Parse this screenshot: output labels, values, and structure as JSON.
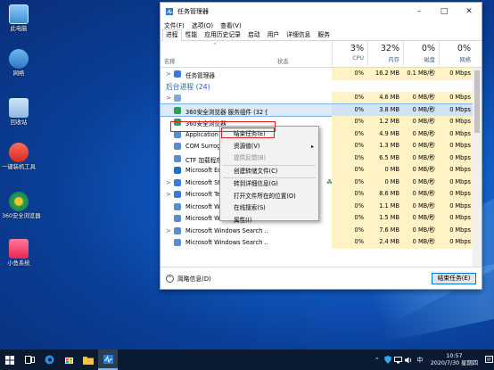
{
  "desktop": {
    "icons": [
      {
        "label": "此电脑",
        "icon": "computer-icon"
      },
      {
        "label": "网络",
        "icon": "network-icon"
      },
      {
        "label": "回收站",
        "icon": "recycle-bin-icon"
      },
      {
        "label": "一键装机工具",
        "icon": "installer-icon"
      },
      {
        "label": "360安全浏览器",
        "icon": "browser-360-icon"
      },
      {
        "label": "小鱼系统",
        "icon": "xiaoyu-icon"
      }
    ]
  },
  "window": {
    "title": "任务管理器",
    "menu": [
      "文件(F)",
      "选项(O)",
      "查看(V)"
    ],
    "tabs": [
      "进程",
      "性能",
      "应用历史记录",
      "启动",
      "用户",
      "详细信息",
      "服务"
    ],
    "selected_tab": 0,
    "columns": {
      "name": "名称",
      "status": "状态",
      "cpu": {
        "pct": "3%",
        "label": "CPU"
      },
      "mem": {
        "pct": "32%",
        "label": "内存"
      },
      "disk": {
        "pct": "0%",
        "label": "磁盘"
      },
      "net": {
        "pct": "0%",
        "label": "网络"
      }
    },
    "rows": [
      {
        "kind": "proc",
        "chev": ">",
        "name": "任务管理器",
        "cpu": "0%",
        "mem": "16.2 MB",
        "disk": "0.1 MB/秒",
        "net": "0 Mbps",
        "color": "#3a7bd5"
      },
      {
        "kind": "group",
        "name": "后台进程 (24)"
      },
      {
        "kind": "proc",
        "chev": ">",
        "name": "",
        "cpu": "0%",
        "mem": "4.6 MB",
        "disk": "0 MB/秒",
        "net": "0 Mbps",
        "color": "#7fa9d6"
      },
      {
        "kind": "proc",
        "chev": "",
        "name": "360安全浏览器 服务组件 (32 位)",
        "cpu": "0%",
        "mem": "3.8 MB",
        "disk": "0 MB/秒",
        "net": "0 Mbps",
        "color": "#2aa05a",
        "selected": true
      },
      {
        "kind": "proc",
        "chev": "",
        "name": "360安全浏览器",
        "cpu": "0%",
        "mem": "1.2 MB",
        "disk": "0 MB/秒",
        "net": "0 Mbps",
        "color": "#2aa05a"
      },
      {
        "kind": "proc",
        "chev": "",
        "name": "Application Frame Host",
        "cpu": "0%",
        "mem": "4.9 MB",
        "disk": "0 MB/秒",
        "net": "0 Mbps",
        "color": "#5b8ccc"
      },
      {
        "kind": "proc",
        "chev": "",
        "name": "COM Surrogate",
        "cpu": "0%",
        "mem": "1.3 MB",
        "disk": "0 MB/秒",
        "net": "0 Mbps",
        "color": "#5b8ccc"
      },
      {
        "kind": "proc",
        "chev": "",
        "name": "CTF 加载程序",
        "cpu": "0%",
        "mem": "6.5 MB",
        "disk": "0 MB/秒",
        "net": "0 Mbps",
        "color": "#5b8ccc"
      },
      {
        "kind": "proc",
        "chev": "",
        "name": "Microsoft Edge",
        "cpu": "0%",
        "mem": "0 MB",
        "disk": "0 MB/秒",
        "net": "0 Mbps",
        "color": "#1f6fc7"
      },
      {
        "kind": "proc",
        "chev": ">",
        "name": "Microsoft Store",
        "cpu": "0%",
        "mem": "0 MB",
        "disk": "0 MB/秒",
        "net": "0 Mbps",
        "color": "#3a7bd5",
        "leaf": true
      },
      {
        "kind": "proc",
        "chev": ">",
        "name": "Microsoft Text Input Application",
        "cpu": "0%",
        "mem": "8.6 MB",
        "disk": "0 MB/秒",
        "net": "0 Mbps",
        "color": "#3a7bd5"
      },
      {
        "kind": "proc",
        "chev": "",
        "name": "Microsoft Windows Search Fi...",
        "cpu": "0%",
        "mem": "1.1 MB",
        "disk": "0 MB/秒",
        "net": "0 Mbps",
        "color": "#5b8ccc"
      },
      {
        "kind": "proc",
        "chev": "",
        "name": "Microsoft Windows Search P...",
        "cpu": "0%",
        "mem": "1.5 MB",
        "disk": "0 MB/秒",
        "net": "0 Mbps",
        "color": "#5b8ccc"
      },
      {
        "kind": "proc",
        "chev": ">",
        "name": "Microsoft Windows Search ...",
        "cpu": "0%",
        "mem": "7.6 MB",
        "disk": "0 MB/秒",
        "net": "0 Mbps",
        "color": "#5b8ccc"
      },
      {
        "kind": "proc",
        "chev": "",
        "name": "Microsoft Windows Search ...",
        "cpu": "0%",
        "mem": "2.4 MB",
        "disk": "0 MB/秒",
        "net": "0 Mbps",
        "color": "#5b8ccc"
      }
    ],
    "footer": {
      "fewer": "简略信息(D)",
      "end_task": "结束任务(E)"
    }
  },
  "context_menu": {
    "items": [
      {
        "label": "结束任务(E)",
        "disabled": false,
        "submenu": false
      },
      {
        "label": "资源值(V)",
        "disabled": false,
        "submenu": true
      },
      {
        "label": "提供反馈(B)",
        "disabled": true,
        "submenu": false
      },
      {
        "sep": true
      },
      {
        "label": "创建转储文件(C)",
        "disabled": false,
        "submenu": false
      },
      {
        "sep": true
      },
      {
        "label": "转到详细信息(G)",
        "disabled": false,
        "submenu": false
      },
      {
        "label": "打开文件所在的位置(O)",
        "disabled": false,
        "submenu": false
      },
      {
        "label": "在线搜索(S)",
        "disabled": false,
        "submenu": false
      },
      {
        "label": "属性(I)",
        "disabled": false,
        "submenu": false
      }
    ]
  },
  "taskbar": {
    "clock_time": "10:57",
    "clock_date": "2020/7/30 星期四",
    "tray_lang": "中"
  }
}
